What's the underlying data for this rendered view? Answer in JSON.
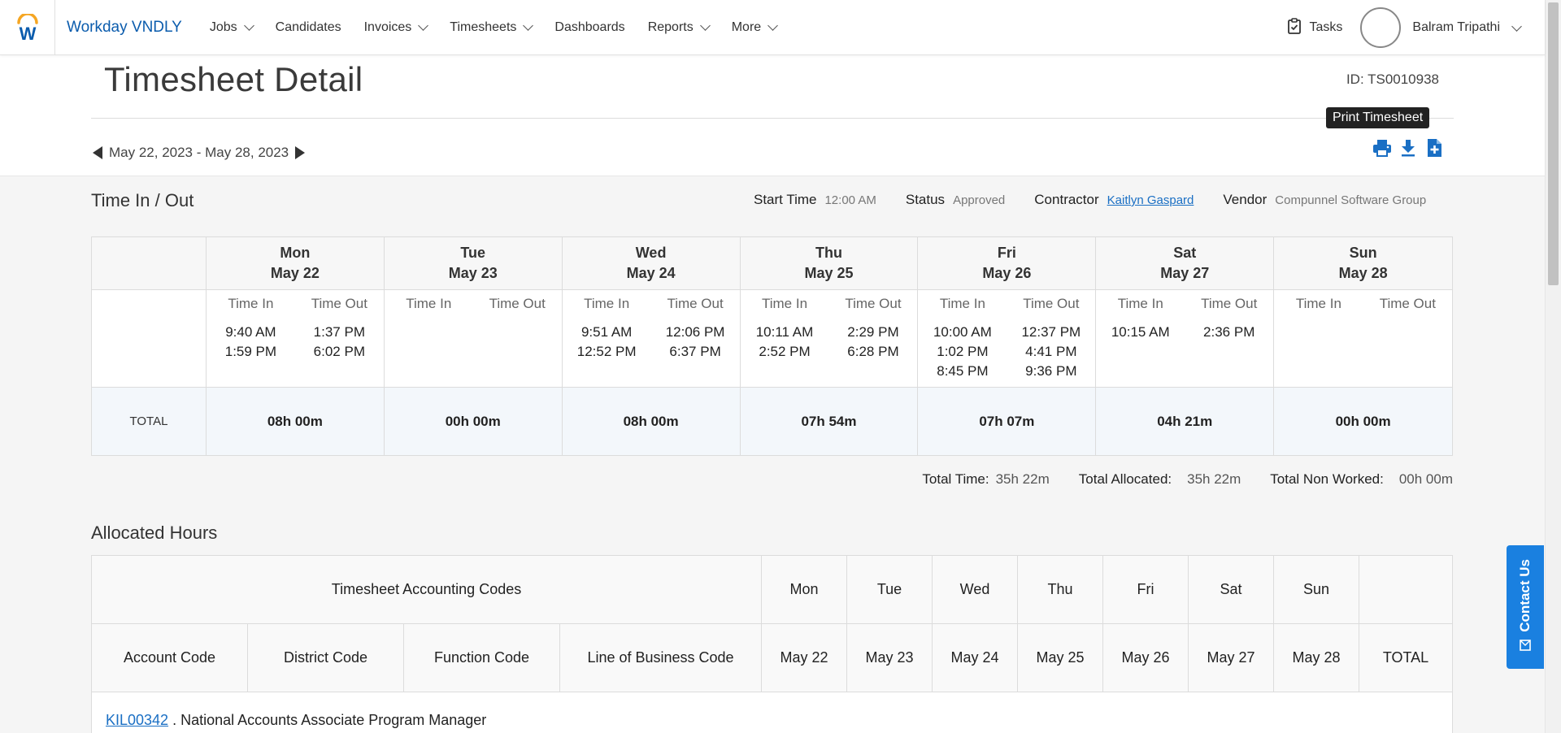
{
  "nav": {
    "brand": "Workday VNDLY",
    "items": [
      {
        "label": "Jobs",
        "dropdown": true
      },
      {
        "label": "Candidates",
        "dropdown": false
      },
      {
        "label": "Invoices",
        "dropdown": true
      },
      {
        "label": "Timesheets",
        "dropdown": true
      },
      {
        "label": "Dashboards",
        "dropdown": false
      },
      {
        "label": "Reports",
        "dropdown": true
      },
      {
        "label": "More",
        "dropdown": true
      }
    ],
    "tasks": "Tasks",
    "user": "Balram Tripathi"
  },
  "header": {
    "title": "Timesheet Detail",
    "id_text": "ID: TS0010938",
    "date_range": "May 22, 2023 - May 28, 2023",
    "tooltip": "Print Timesheet"
  },
  "time_section": {
    "title": "Time In / Out",
    "start_time_label": "Start Time",
    "start_time": "12:00 AM",
    "status_label": "Status",
    "status": "Approved",
    "contractor_label": "Contractor",
    "contractor": "Kaitlyn Gaspard",
    "vendor_label": "Vendor",
    "vendor": "Compunnel Software Group",
    "time_in_label": "Time In",
    "time_out_label": "Time Out",
    "total_label": "TOTAL",
    "days": [
      {
        "day": "Mon",
        "date": "May 22",
        "in": [
          "9:40 AM",
          "1:59 PM"
        ],
        "out": [
          "1:37 PM",
          "6:02 PM"
        ],
        "total": "08h 00m"
      },
      {
        "day": "Tue",
        "date": "May 23",
        "in": [],
        "out": [],
        "total": "00h 00m"
      },
      {
        "day": "Wed",
        "date": "May 24",
        "in": [
          "9:51 AM",
          "12:52 PM"
        ],
        "out": [
          "12:06 PM",
          "6:37 PM"
        ],
        "total": "08h 00m"
      },
      {
        "day": "Thu",
        "date": "May 25",
        "in": [
          "10:11 AM",
          "2:52 PM"
        ],
        "out": [
          "2:29 PM",
          "6:28 PM"
        ],
        "total": "07h 54m"
      },
      {
        "day": "Fri",
        "date": "May 26",
        "in": [
          "10:00 AM",
          "1:02 PM",
          "8:45 PM"
        ],
        "out": [
          "12:37 PM",
          "4:41 PM",
          "9:36 PM"
        ],
        "total": "07h 07m"
      },
      {
        "day": "Sat",
        "date": "May 27",
        "in": [
          "10:15 AM"
        ],
        "out": [
          "2:36 PM"
        ],
        "total": "04h 21m"
      },
      {
        "day": "Sun",
        "date": "May 28",
        "in": [],
        "out": [],
        "total": "00h 00m"
      }
    ],
    "totals": {
      "total_time_label": "Total Time:",
      "total_time": "35h 22m",
      "total_allocated_label": "Total Allocated:",
      "total_allocated": "35h 22m",
      "total_non_worked_label": "Total Non Worked:",
      "total_non_worked": "00h 00m"
    }
  },
  "allocated": {
    "title": "Allocated Hours",
    "codes_header": "Timesheet Accounting Codes",
    "code_columns": [
      "Account Code",
      "District Code",
      "Function Code",
      "Line of Business Code"
    ],
    "days": [
      "Mon",
      "Tue",
      "Wed",
      "Thu",
      "Fri",
      "Sat",
      "Sun"
    ],
    "dates": [
      "May 22",
      "May 23",
      "May 24",
      "May 25",
      "May 26",
      "May 27",
      "May 28"
    ],
    "total_label": "TOTAL",
    "account_code": "KIL00342",
    "account_desc": ". National Accounts Associate Program Manager"
  },
  "contact_us": "Contact Us"
}
